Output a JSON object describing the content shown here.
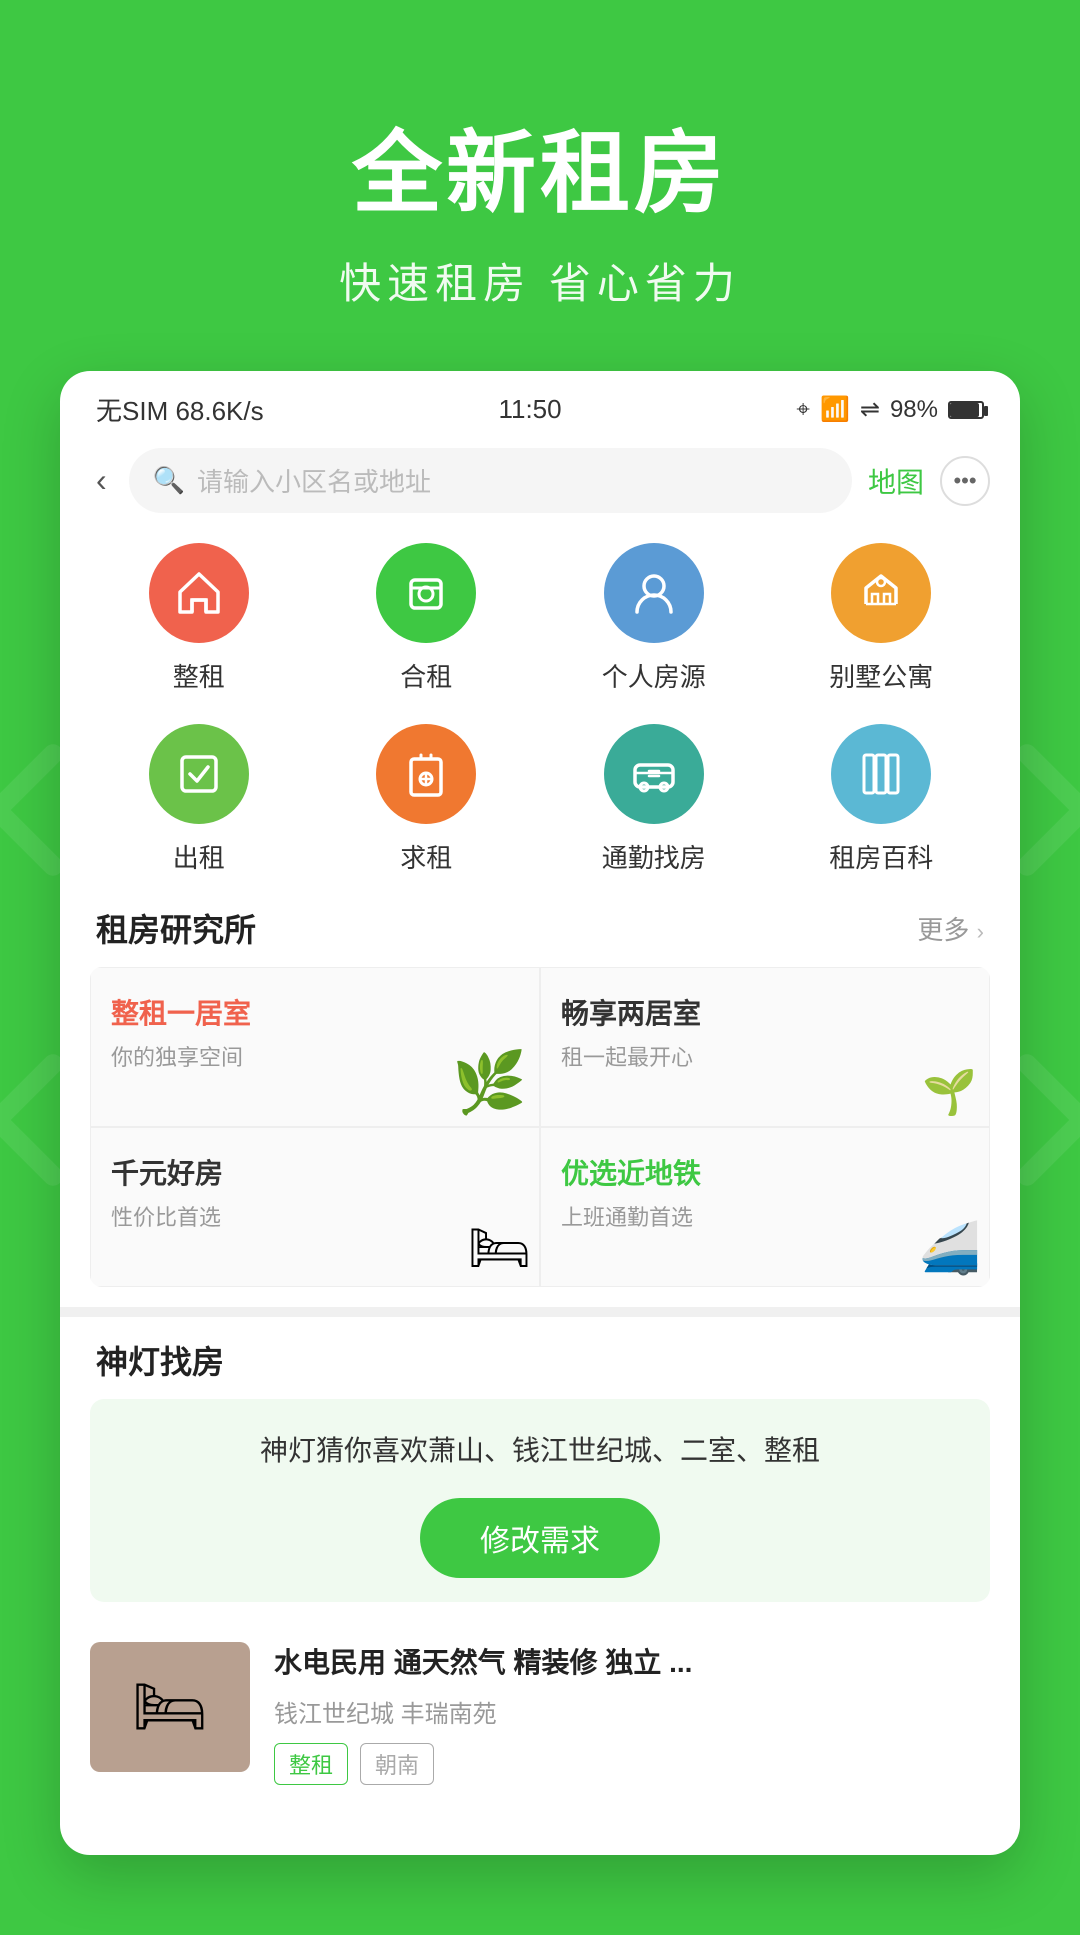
{
  "header": {
    "title": "全新租房",
    "subtitle": "快速租房  省心省力"
  },
  "statusBar": {
    "left": "无SIM 68.6K/s",
    "center": "11:50",
    "right": "98%"
  },
  "searchBar": {
    "placeholder": "请输入小区名或地址",
    "mapLabel": "地图"
  },
  "iconGrid": {
    "items": [
      {
        "label": "整租",
        "icon": "🏠",
        "color": "ic-red"
      },
      {
        "label": "合租",
        "icon": "🧳",
        "color": "ic-green"
      },
      {
        "label": "个人房源",
        "icon": "👤",
        "color": "ic-blue"
      },
      {
        "label": "别墅公寓",
        "icon": "🏛",
        "color": "ic-yellow"
      },
      {
        "label": "出租",
        "icon": "✏️",
        "color": "ic-lgreen"
      },
      {
        "label": "求租",
        "icon": "🚪",
        "color": "ic-orange"
      },
      {
        "label": "通勤找房",
        "icon": "🚌",
        "color": "ic-teal"
      },
      {
        "label": "租房百科",
        "icon": "📚",
        "color": "ic-lblue"
      }
    ]
  },
  "researchSection": {
    "title": "租房研究所",
    "moreLabel": "更多",
    "cells": [
      {
        "title": "整租一居室",
        "titleColor": "red",
        "subtitle": "你的独享空间",
        "emoji": "🌿"
      },
      {
        "title": "畅享两居室",
        "titleColor": "black",
        "subtitle": "租一起最开心",
        "emoji": "🌱"
      },
      {
        "title": "千元好房",
        "titleColor": "black",
        "subtitle": "性价比首选",
        "emoji": "🛏"
      },
      {
        "title": "优选近地铁",
        "titleColor": "green",
        "subtitle": "上班通勤首选",
        "emoji": "🚄"
      }
    ]
  },
  "shendengSection": {
    "title": "神灯找房",
    "guessText": "神灯猜你喜欢萧山、钱江世纪城、二室、整租",
    "modifyLabel": "修改需求"
  },
  "listingCard": {
    "title": "水电民用 通天然气 精装修 独立 ...",
    "location": "钱江世纪城  丰瑞南苑",
    "tags": [
      "整租",
      "朝南"
    ],
    "emoji": "🛏"
  }
}
